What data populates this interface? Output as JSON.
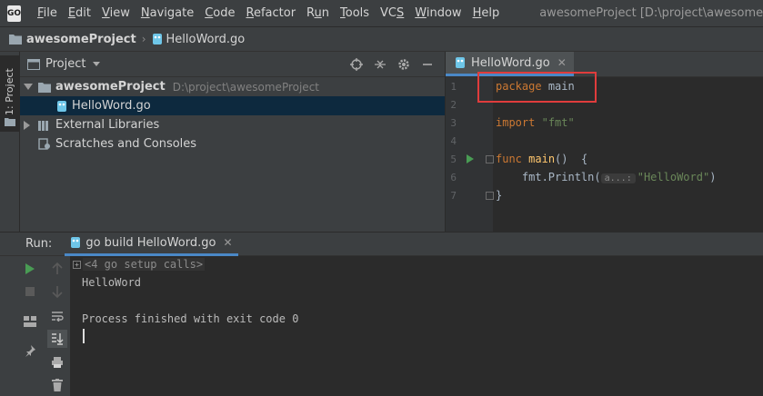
{
  "app": {
    "icon_text": "GO",
    "title": "awesomeProject [D:\\project\\awesomeProject] - ...\\"
  },
  "menu": [
    {
      "pre": "",
      "ul": "F",
      "post": "ile"
    },
    {
      "pre": "",
      "ul": "E",
      "post": "dit"
    },
    {
      "pre": "",
      "ul": "V",
      "post": "iew"
    },
    {
      "pre": "",
      "ul": "N",
      "post": "avigate"
    },
    {
      "pre": "",
      "ul": "C",
      "post": "ode"
    },
    {
      "pre": "",
      "ul": "R",
      "post": "efactor"
    },
    {
      "pre": "R",
      "ul": "u",
      "post": "n"
    },
    {
      "pre": "",
      "ul": "T",
      "post": "ools"
    },
    {
      "pre": "VC",
      "ul": "S",
      "post": ""
    },
    {
      "pre": "",
      "ul": "W",
      "post": "indow"
    },
    {
      "pre": "",
      "ul": "H",
      "post": "elp"
    }
  ],
  "breadcrumb": {
    "project": "awesomeProject",
    "file": "HelloWord.go"
  },
  "left_stripe": {
    "label": "1: Project"
  },
  "project_panel": {
    "title": "Project",
    "tree": {
      "root_name": "awesomeProject",
      "root_path": "D:\\project\\awesomeProject",
      "file": "HelloWord.go",
      "external": "External Libraries",
      "scratches": "Scratches and Consoles"
    }
  },
  "editor": {
    "tab_label": "HelloWord.go",
    "line_numbers": [
      "1",
      "2",
      "3",
      "4",
      "5",
      "6",
      "7"
    ],
    "code": {
      "l1_kw": "package",
      "l1_id": "main",
      "l3_kw": "import",
      "l3_str": "\"fmt\"",
      "l5_kw": "func",
      "l5_fn": "main",
      "l5_rest": "()  {",
      "l6_call": "fmt.Println(",
      "l6_hint": "a...:",
      "l6_str": "\"HelloWord\"",
      "l6_close": ")",
      "l7": "}"
    }
  },
  "run": {
    "label": "Run:",
    "tab_label": "go build HelloWord.go",
    "console": {
      "setup": "<4 go setup calls>",
      "output": "HelloWord",
      "exit": "Process finished with exit code 0"
    }
  },
  "colors": {
    "highlight_box": "#e03c3c",
    "accent": "#4a88c7",
    "run_green": "#499c54"
  }
}
